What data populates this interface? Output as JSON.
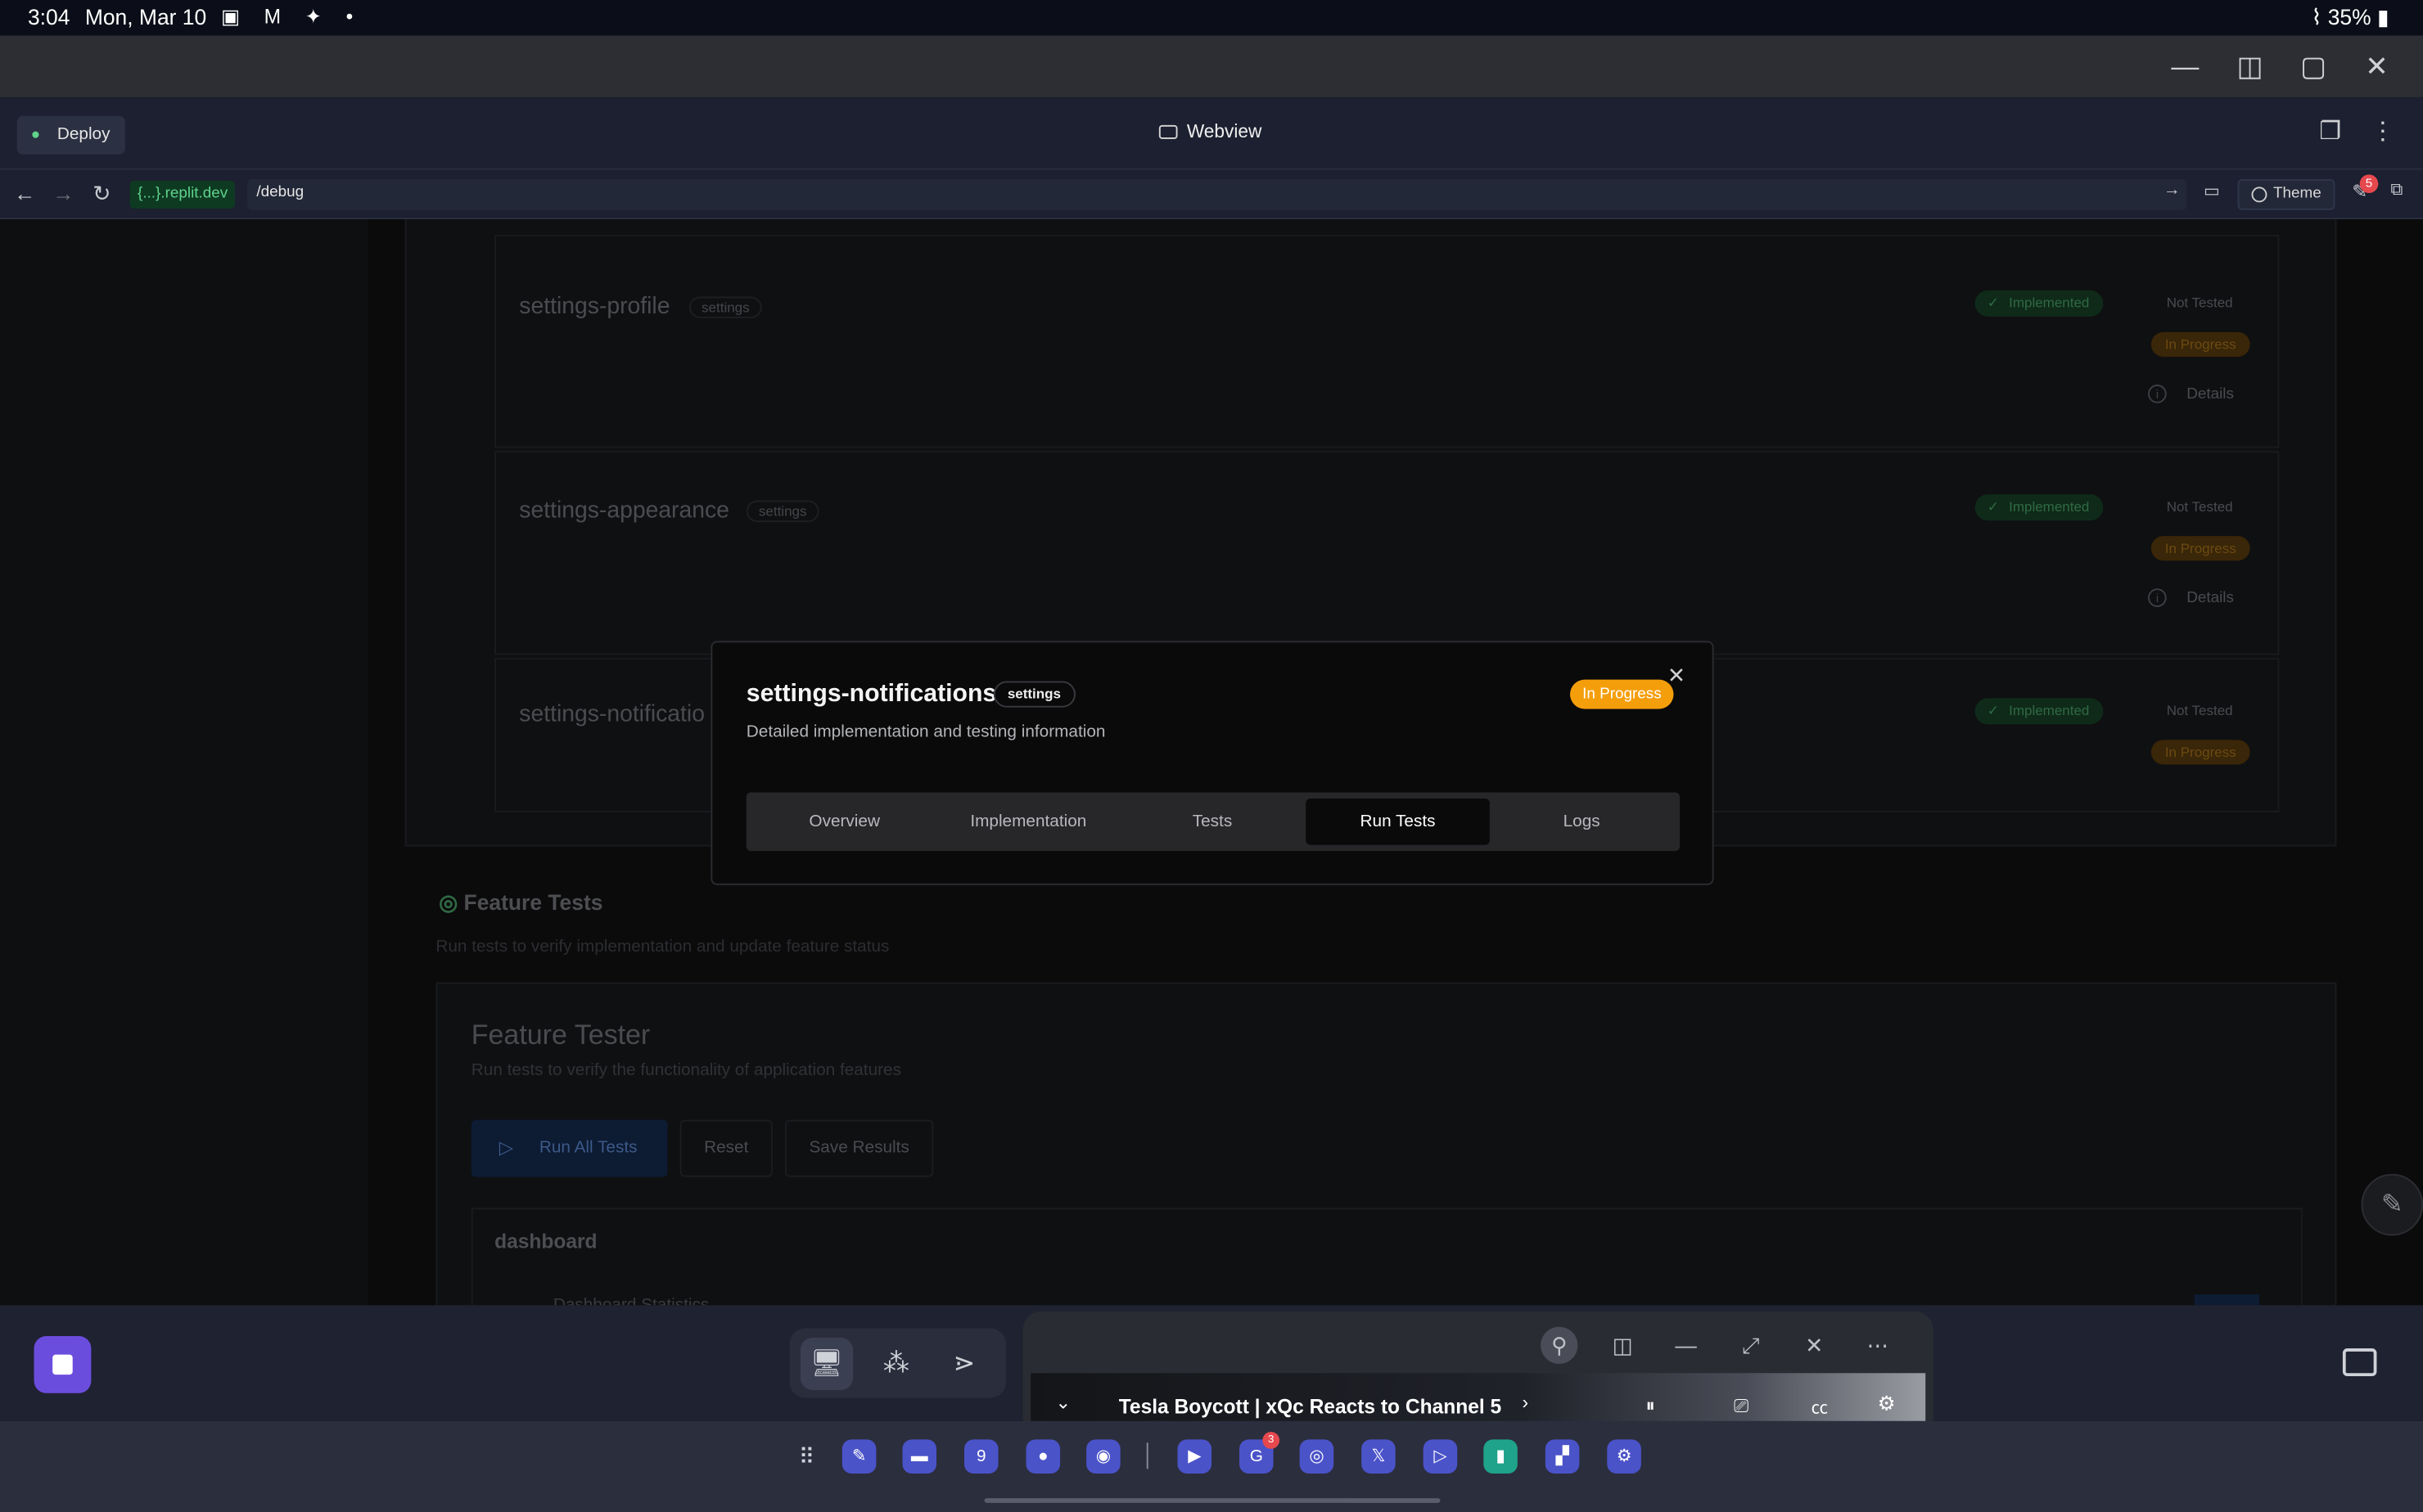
{
  "status_bar": {
    "time": "3:04",
    "date": "Mon, Mar 10",
    "battery": "35%"
  },
  "header": {
    "deploy_label": "Deploy",
    "title": "Webview"
  },
  "urlbar": {
    "host": "{...}.replit.dev",
    "path": "/debug",
    "theme_label": "Theme",
    "notification_count": "5"
  },
  "features": [
    {
      "name": "settings-profile",
      "category": "settings",
      "implemented": "Implemented",
      "tested": "Not Tested",
      "progress": "In Progress",
      "details": "Details"
    },
    {
      "name": "settings-appearance",
      "category": "settings",
      "implemented": "Implemented",
      "tested": "Not Tested",
      "progress": "In Progress",
      "details": "Details"
    },
    {
      "name": "settings-notificatio",
      "category": "settings",
      "implemented": "Implemented",
      "tested": "Not Tested",
      "progress": "In Progress"
    }
  ],
  "feature_tests": {
    "title": "Feature Tests",
    "subtitle": "Run tests to verify implementation and update feature status",
    "tester_title": "Feature Tester",
    "tester_subtitle": "Run tests to verify the functionality of application features",
    "run_all": "Run All Tests",
    "reset": "Reset",
    "save": "Save Results",
    "group": "dashboard",
    "group_item": "Dashboard Statistics"
  },
  "modal": {
    "title": "settings-notifications",
    "tag": "settings",
    "description": "Detailed implementation and testing information",
    "status": "In Progress",
    "tabs": [
      "Overview",
      "Implementation",
      "Tests",
      "Run Tests",
      "Logs"
    ],
    "active_tab": "Run Tests"
  },
  "pip": {
    "video_title": "Tesla Boycott | xQc Reacts to Channel 5"
  },
  "dock": {
    "gmail_badge": "3",
    "calendar_day": "9"
  },
  "colors": {
    "accent_orange": "#f59e0b",
    "stop_button": "#6b4dde",
    "url_green": "#5fd38b"
  }
}
